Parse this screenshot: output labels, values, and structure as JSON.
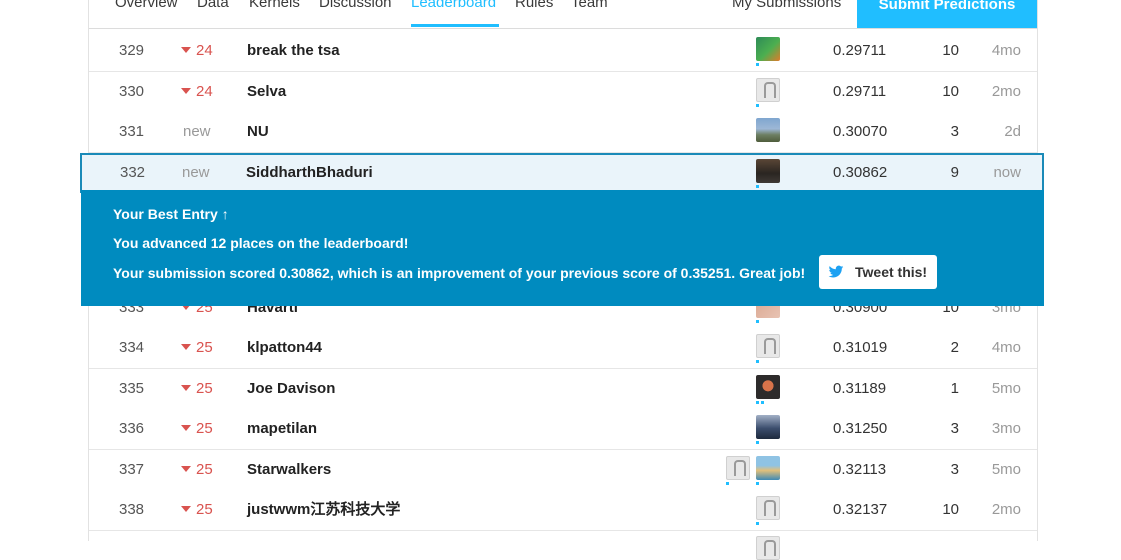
{
  "tabs": [
    "Overview",
    "Data",
    "Kernels",
    "Discussion",
    "Leaderboard",
    "Rules",
    "Team"
  ],
  "my_submissions": "My Submissions",
  "submit_predictions": "Submit Predictions",
  "rows": [
    {
      "rank": "329",
      "delta": "24",
      "delta_type": "down",
      "team": "break the tsa",
      "score": "0.29711",
      "entries": "10",
      "last": "4mo"
    },
    {
      "rank": "330",
      "delta": "24",
      "delta_type": "down",
      "team": "Selva",
      "score": "0.29711",
      "entries": "10",
      "last": "2mo"
    },
    {
      "rank": "331",
      "delta": "new",
      "delta_type": "new",
      "team": "NU",
      "score": "0.30070",
      "entries": "3",
      "last": "2d"
    },
    {
      "rank": "332",
      "delta": "new",
      "delta_type": "new",
      "team": "SiddharthBhaduri",
      "score": "0.30862",
      "entries": "9",
      "last": "now"
    },
    {
      "rank": "333",
      "delta": "25",
      "delta_type": "down",
      "team": "Havarti",
      "score": "0.30900",
      "entries": "10",
      "last": "3mo"
    },
    {
      "rank": "334",
      "delta": "25",
      "delta_type": "down",
      "team": "klpatton44",
      "score": "0.31019",
      "entries": "2",
      "last": "4mo"
    },
    {
      "rank": "335",
      "delta": "25",
      "delta_type": "down",
      "team": "Joe Davison",
      "score": "0.31189",
      "entries": "1",
      "last": "5mo"
    },
    {
      "rank": "336",
      "delta": "25",
      "delta_type": "down",
      "team": "mapetilan",
      "score": "0.31250",
      "entries": "3",
      "last": "3mo"
    },
    {
      "rank": "337",
      "delta": "25",
      "delta_type": "down",
      "team": "Starwalkers",
      "score": "0.32113",
      "entries": "3",
      "last": "5mo"
    },
    {
      "rank": "338",
      "delta": "25",
      "delta_type": "down",
      "team": "justwwm江苏科技大学",
      "score": "0.32137",
      "entries": "10",
      "last": "2mo"
    }
  ],
  "banner": {
    "title": "Your Best Entry",
    "line1": "You advanced 12 places on the leaderboard!",
    "line2": "Your submission scored 0.30862, which is an improvement of your previous score of 0.35251. Great job!",
    "tweet_label": "Tweet this!"
  },
  "colors": {
    "accent": "#20beff",
    "banner": "#008bbf",
    "delta_down": "#d9534f"
  }
}
